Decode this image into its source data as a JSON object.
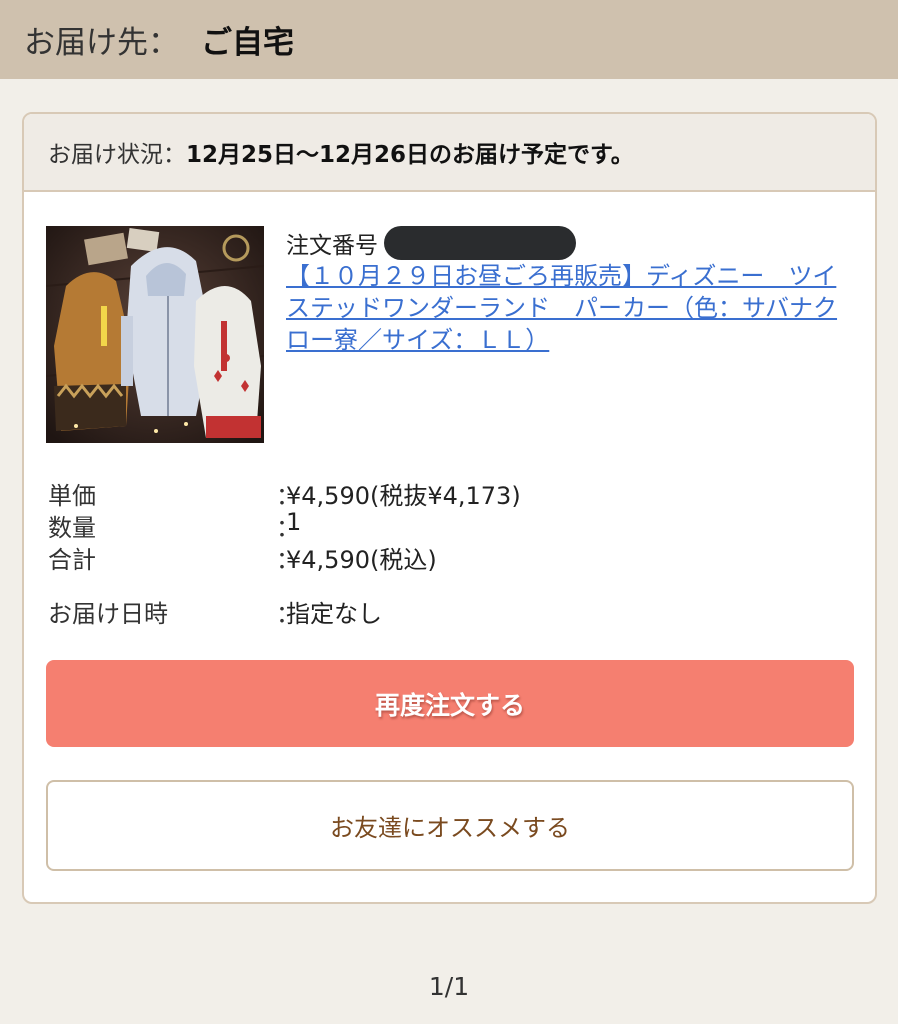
{
  "destination": {
    "label": "お届け先：",
    "value": "ご自宅"
  },
  "order": {
    "status_label": "お届け状況：",
    "status_value": "12月25日〜12月26日のお届け予定です。",
    "order_number_label": "注文番号",
    "product_title": "【１０月２９日お昼ごろ再販売】ディズニー　ツイステッドワンダーランド　パーカー（色：サバナクロー寮／サイズ：ＬＬ）",
    "details": {
      "unit_price_label": "単価",
      "unit_price_value": "¥4,590(税抜¥4,173)",
      "quantity_label": "数量",
      "quantity_value": "1",
      "total_label": "合計",
      "total_value": "¥4,590(税込)",
      "delivery_time_label": "お届け日時",
      "delivery_time_value": "指定なし",
      "separator": "："
    },
    "reorder_label": "再度注文する",
    "recommend_label": "お友達にオススメする"
  },
  "pagination": {
    "text": "1/1"
  },
  "colors": {
    "header_bg": "#cfc1ae",
    "page_bg": "#f2efe9",
    "reorder_button": "#f57f70",
    "link": "#3a6fd0",
    "recommend_text": "#7a4a1f"
  }
}
